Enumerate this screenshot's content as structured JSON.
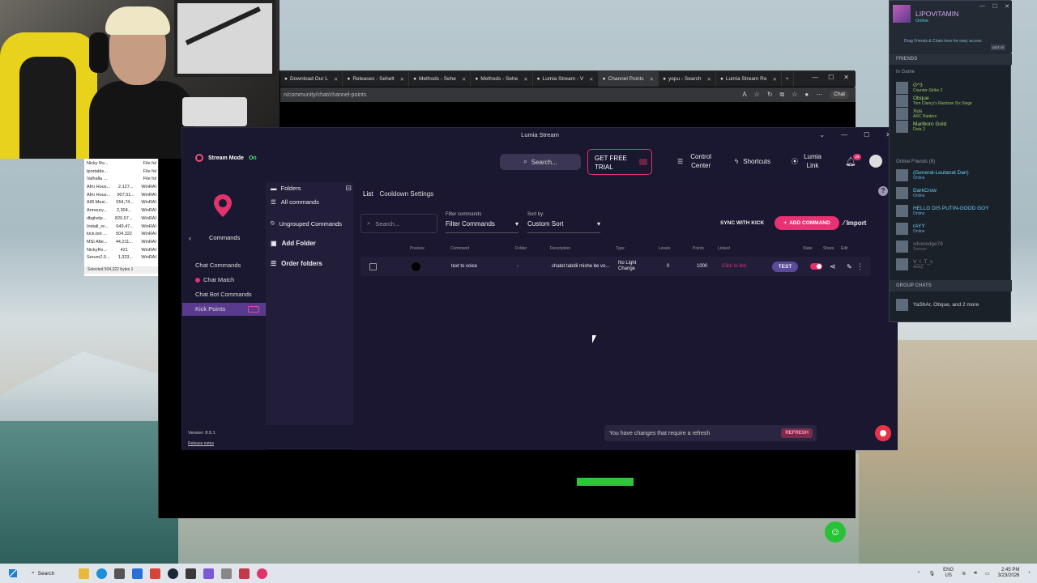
{
  "browser": {
    "tabs": [
      {
        "label": "Download Our L"
      },
      {
        "label": "Releases - Sehelt"
      },
      {
        "label": "Methods - Sehe"
      },
      {
        "label": "Methods - Sehe"
      },
      {
        "label": "Lumia Stream - V"
      },
      {
        "label": "Channel Points"
      },
      {
        "label": "yopu - Search"
      },
      {
        "label": "Lumia Stream Re"
      }
    ],
    "address": "n/community/chat/channel-points",
    "chat_label": "Chat"
  },
  "lumia": {
    "window_title": "Lumia Stream",
    "stream_mode_label": "Stream Mode",
    "stream_mode_state": "On",
    "search_label": "Search...",
    "trial_label": "GET FREE TRIAL",
    "nav": {
      "control_center": "Control Center",
      "shortcuts": "Shortcuts",
      "lumia_link": "Lumia Link"
    },
    "notification_count": "29",
    "sidebar": {
      "title": "Commands",
      "items": [
        {
          "label": "Chat Commands"
        },
        {
          "label": "Chat Match"
        },
        {
          "label": "Chat Bot Commands"
        },
        {
          "label": "Kick Points"
        }
      ],
      "version": "Version: 8.9.1",
      "release_notes": "Release notes"
    },
    "folders": {
      "title": "Folders",
      "all": "All commands",
      "ungrouped": "Ungrouped Commands",
      "add": "Add Folder",
      "order": "Order folders"
    },
    "tabs": [
      {
        "label": "List"
      },
      {
        "label": "Cooldown Settings"
      }
    ],
    "toolbar": {
      "search_placeholder": "Search...",
      "filter_label": "Filter commands",
      "filter_value": "Filter Commands",
      "sort_label": "Sort by:",
      "sort_value": "Custom Sort",
      "sync_label": "SYNC WITH KICK",
      "add_label": "ADD COMMAND",
      "import_label": "Import"
    },
    "columns": [
      "Preview",
      "Command",
      "Folder",
      "Description",
      "Type",
      "Levels",
      "Points",
      "Linked",
      "State",
      "Share",
      "Edit"
    ],
    "rows": [
      {
        "command": "text to voice",
        "folder": "-",
        "description": "chatet tabdil mishe be vo...",
        "type": "No Light Change",
        "levels": "0",
        "points": "1000",
        "linked": "Click to link",
        "test_label": "TEST"
      }
    ],
    "refresh_notice": "You have changes that require a refresh",
    "refresh_label": "REFRESH"
  },
  "files": {
    "rows": [
      {
        "name": "Nicky Ro...",
        "size": "",
        "type": "File fol"
      },
      {
        "name": "tportable...",
        "size": "",
        "type": "File fol"
      },
      {
        "name": "Valhalla ...",
        "size": "",
        "type": "File fol"
      },
      {
        "name": "Afro Hous...",
        "size": "2,127...",
        "type": "WinRAI"
      },
      {
        "name": "Afro Hous...",
        "size": "907,51...",
        "type": "WinRAI"
      },
      {
        "name": "AIR.Musi...",
        "size": "554,74...",
        "type": "WinRAI"
      },
      {
        "name": "Armoury...",
        "size": "2,304...",
        "type": "WinRAI"
      },
      {
        "name": "dbghelp...",
        "size": "820,57...",
        "type": "WinRAI"
      },
      {
        "name": "Install_re...",
        "size": "649,47...",
        "type": "WinRAI"
      },
      {
        "name": "kick.bot ...",
        "size": "504,322",
        "type": "WinRAI"
      },
      {
        "name": "MSI Afte...",
        "size": "44,211...",
        "type": "WinRAI"
      },
      {
        "name": "NickyRo...",
        "size": "421",
        "type": "WinRAI"
      },
      {
        "name": "Serum2.0...",
        "size": "1,323...",
        "type": "WinRAI"
      }
    ],
    "status": "Selected 504,322 bytes 1"
  },
  "steam": {
    "user": "LIPOVITAMIN",
    "user_status": "Online",
    "drag_hint": "Drag Friends & Chats here for easy access",
    "got_it": "GOT IT!",
    "friends_header": "FRIENDS",
    "in_game_header": "In Game",
    "online_header": "Online Friends",
    "online_count": "(6)",
    "group_header": "GROUP CHATS",
    "in_game": [
      {
        "name": "G^3",
        "status": "Counter-Strike 2"
      },
      {
        "name": "Obque",
        "status": "Tom Clancy's Rainbow Six Siege"
      },
      {
        "name": "Xus",
        "status": "ARC Raiders"
      },
      {
        "name": "Marlboro Gold",
        "status": "Dota 2"
      }
    ],
    "online": [
      {
        "name": "(General-Leutanat Dan)",
        "status": "Online",
        "state": "online"
      },
      {
        "name": "DarkCrow",
        "status": "Online",
        "state": "online"
      },
      {
        "name": "HELLO DIS PUTIN-GOOD GOY",
        "status": "Online",
        "state": "online"
      },
      {
        "name": "rAYY",
        "status": "Online",
        "state": "online"
      },
      {
        "name": "silveredge78",
        "status": "Snooze",
        "state": "offline"
      },
      {
        "name": "V_I_T_s",
        "status": "Away",
        "state": "offline"
      }
    ],
    "group": "YaShAr, Obque, and 2 more"
  },
  "taskbar": {
    "search_label": "Search",
    "lang": "ENG",
    "region": "US",
    "time": "2:45 PM",
    "date": "3/23/2026"
  },
  "colors": {
    "accent_pink": "#e83273",
    "sidebar_active": "#5a3a8e",
    "app_bg": "#1a1730"
  }
}
